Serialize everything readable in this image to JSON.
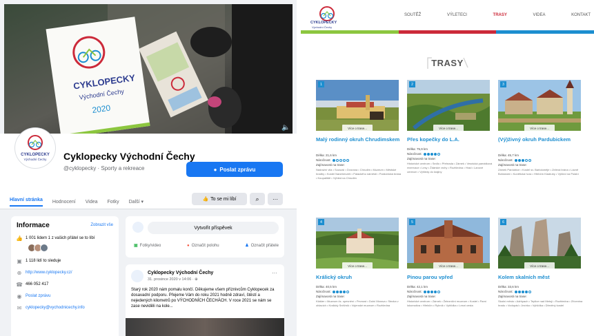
{
  "facebook": {
    "cover": {
      "brochure_title": "CYKLOPECKY",
      "brochure_subtitle": "Východní Čechy",
      "brochure_year": "2020"
    },
    "avatar": {
      "title": "CYKLOPECKY",
      "subtitle": "Východní Čechy"
    },
    "page_name": "Cyklopecky Východní Čechy",
    "handle": "@cyklopecky · Sporty a rekreace",
    "message_button": "Poslat zprávu",
    "tabs": [
      {
        "label": "Hlavní stránka",
        "active": true
      },
      {
        "label": "Hodnocení",
        "active": false
      },
      {
        "label": "Videa",
        "active": false
      },
      {
        "label": "Fotky",
        "active": false
      },
      {
        "label": "Další ▾",
        "active": false
      }
    ],
    "like_button": "To se mi líbí",
    "info": {
      "title": "Informace",
      "edit": "Zobrazit vše",
      "likes": "1 001 lidem 1 z vašich přátel se to líbí",
      "followers": "1 118 lidí to sleduje",
      "website": "http://www.cyklopecky.cz/",
      "phone": "466 052 417",
      "send_message": "Poslat zprávu",
      "email": "cyklopecky@vychodnicechy.info"
    },
    "create_post": {
      "placeholder": "Vytvořit příspěvek",
      "photo_video": "Fotky/video",
      "checkin": "Označit polohu",
      "tag_friends": "Označit přátele"
    },
    "post": {
      "author": "Cyklopecky Východní Čechy",
      "date": "31. prosince 2020 v 14:06 · ⊕",
      "text": "Starý rok 2020 nám pomalu končí. Děkujeme všem příznivcům Cyklopecek za dosavadní podporu. Přejeme Vám do roku 2021 hodně zdraví, štěstí a nejedených kilometrů po VÝCHODNÍCH ČECHÁCH. V roce 2021 se nám se zase neviděli na kole..."
    }
  },
  "website": {
    "logo": {
      "title": "CYKLOPECKY",
      "subtitle": "Východní Čechy"
    },
    "nav": [
      {
        "label": "SOUTĚŽ",
        "active": false
      },
      {
        "label": "VÝLETECI",
        "active": false
      },
      {
        "label": "TRASY",
        "active": true
      },
      {
        "label": "VIDEA",
        "active": false
      },
      {
        "label": "KONTAKT",
        "active": false
      }
    ],
    "bar_colors": [
      "#8cc63f",
      "#cc2a3a",
      "#1c8ed0"
    ],
    "heading": "TRASY",
    "more_label": "Více o trase...",
    "cards": [
      {
        "num": "1",
        "title": "Malý rodinný okruh Chrudimskem",
        "length": "Délka: 21,6 km",
        "difficulty_label": "Náročnost:",
        "difficulty": 1,
        "highlights_label": "Zajímavosti na trase:",
        "list": "Nádražní vila • Sousoší • Dvorana • Chrudim • Muzeum • Městské hradby • Kostel Nanebevzetí • Palackého náměstí • Pardubická brána • Koupaliště • Výhled na Chrudim"
      },
      {
        "num": "2",
        "title": "Přes kopečky do L.A.",
        "length": "Délka: 75,9 km",
        "difficulty_label": "Náročnost:",
        "difficulty": 4,
        "highlights_label": "Zajímavosti na trase:",
        "list": "Historické centrum • Sedlo • Přehrada • Zámek • Vesnická památková rezervace • Lesy • Ždárské vrchy • Rozhledna • Hrad • Lanové centrum • Výhledy do krajiny"
      },
      {
        "num": "3",
        "title": "(Vý)živný okruh Pardubickem",
        "length": "Délka: 45,7 km",
        "difficulty_label": "Náročnost:",
        "difficulty": 3,
        "highlights_label": "Zajímavosti na trase:",
        "list": "Zámek Pardubice • Kostel sv. Bartoloměje • Zelená brána • Lázně Bohdaneč • Kunětická hora • Hřebčín Kladruby • Výhled na Polabí"
      },
      {
        "num": "4",
        "title": "Králický okruh",
        "length": "Délka: 40,5 km",
        "difficulty_label": "Náročnost:",
        "difficulty": 4,
        "highlights_label": "Zajímavosti na trase:",
        "list": "Klášter • Muzeum čs. opevnění • Pevnost • Dolní Morava • Stezka v oblacích • Kralický Sněžník • Vojenské muzeum • Rozhledna"
      },
      {
        "num": "5",
        "title": "Pinou parou vpřed",
        "length": "Délka: 42,1 km",
        "difficulty_label": "Náročnost:",
        "difficulty": 4,
        "highlights_label": "Zajímavosti na trase:",
        "list": "Historické centrum • Zámek • Železniční muzeum • Kostel • Parní lokomotiva • Hřebčín • Rybník • Vyhlídka • Lesní cesta"
      },
      {
        "num": "6",
        "title": "Kolem skalních měst",
        "length": "Délka: 33,6 km",
        "difficulty_label": "Náročnost:",
        "difficulty": 4,
        "highlights_label": "Zajímavosti na trase:",
        "list": "Skalní město • Adršpach • Teplice nad Metují • Rozhledna • Zřícenina hradu • Vodopád • Jezírko • Vyhlídka • Dřevěný kostel"
      }
    ]
  }
}
